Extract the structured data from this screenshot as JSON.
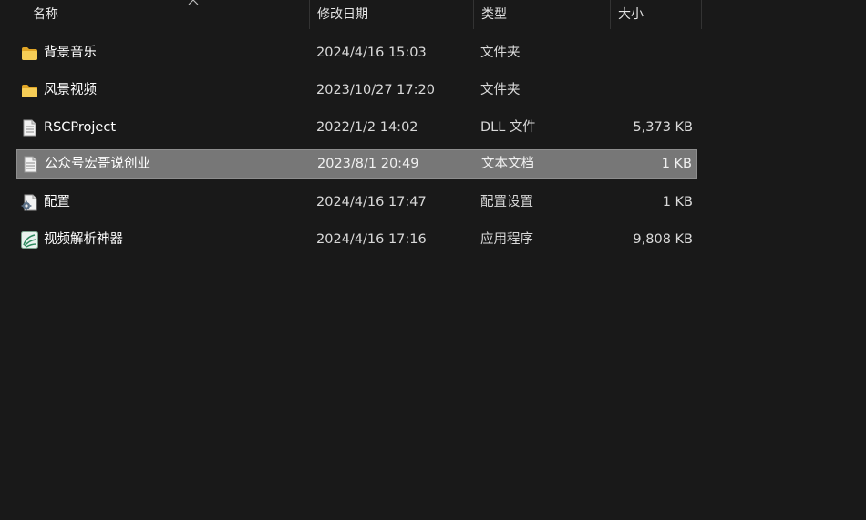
{
  "columns": {
    "name": "名称",
    "date": "修改日期",
    "type": "类型",
    "size": "大小"
  },
  "files": [
    {
      "name": "背景音乐",
      "date": "2024/4/16 15:03",
      "type": "文件夹",
      "size": "",
      "icon": "folder-icon"
    },
    {
      "name": "风景视频",
      "date": "2023/10/27 17:20",
      "type": "文件夹",
      "size": "",
      "icon": "folder-icon"
    },
    {
      "name": "RSCProject",
      "date": "2022/1/2 14:02",
      "type": "DLL 文件",
      "size": "5,373 KB",
      "icon": "document-icon"
    },
    {
      "name": "公众号宏哥说创业",
      "date": "2023/8/1 20:49",
      "type": "文本文档",
      "size": "1 KB",
      "icon": "text-file-icon",
      "selected": true
    },
    {
      "name": "配置",
      "date": "2024/4/16 17:47",
      "type": "配置设置",
      "size": "1 KB",
      "icon": "config-file-icon"
    },
    {
      "name": "视频解析神器",
      "date": "2024/4/16 17:16",
      "type": "应用程序",
      "size": "9,808 KB",
      "icon": "app-icon"
    }
  ],
  "colors": {
    "background": "#191919",
    "selection": "#777777",
    "folder": "#f3c44a"
  }
}
